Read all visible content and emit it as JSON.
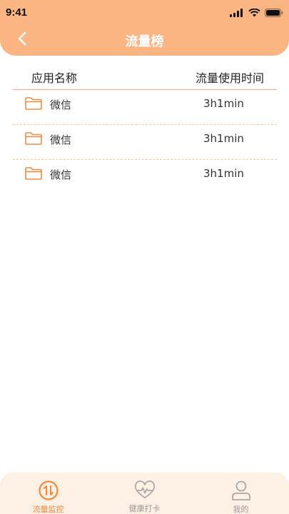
{
  "status_bar": {
    "time": "9:41"
  },
  "header": {
    "title": "流量榜"
  },
  "table": {
    "columns": {
      "name": "应用名称",
      "time": "流量使用时间"
    },
    "rows": [
      {
        "app": "微信",
        "time": "3h1min"
      },
      {
        "app": "微信",
        "time": "3h1min"
      },
      {
        "app": "微信",
        "time": "3h1min"
      }
    ]
  },
  "tabbar": {
    "tabs": [
      {
        "label": "流量监控",
        "icon": "traffic-icon",
        "active": true
      },
      {
        "label": "健康打卡",
        "icon": "heartbeat-icon",
        "active": false
      },
      {
        "label": "我的",
        "icon": "person-icon",
        "active": false
      }
    ]
  },
  "colors": {
    "accent": "#fbb582",
    "accent_dark": "#f08a3e",
    "tabbar_bg": "#fdf0e4"
  }
}
